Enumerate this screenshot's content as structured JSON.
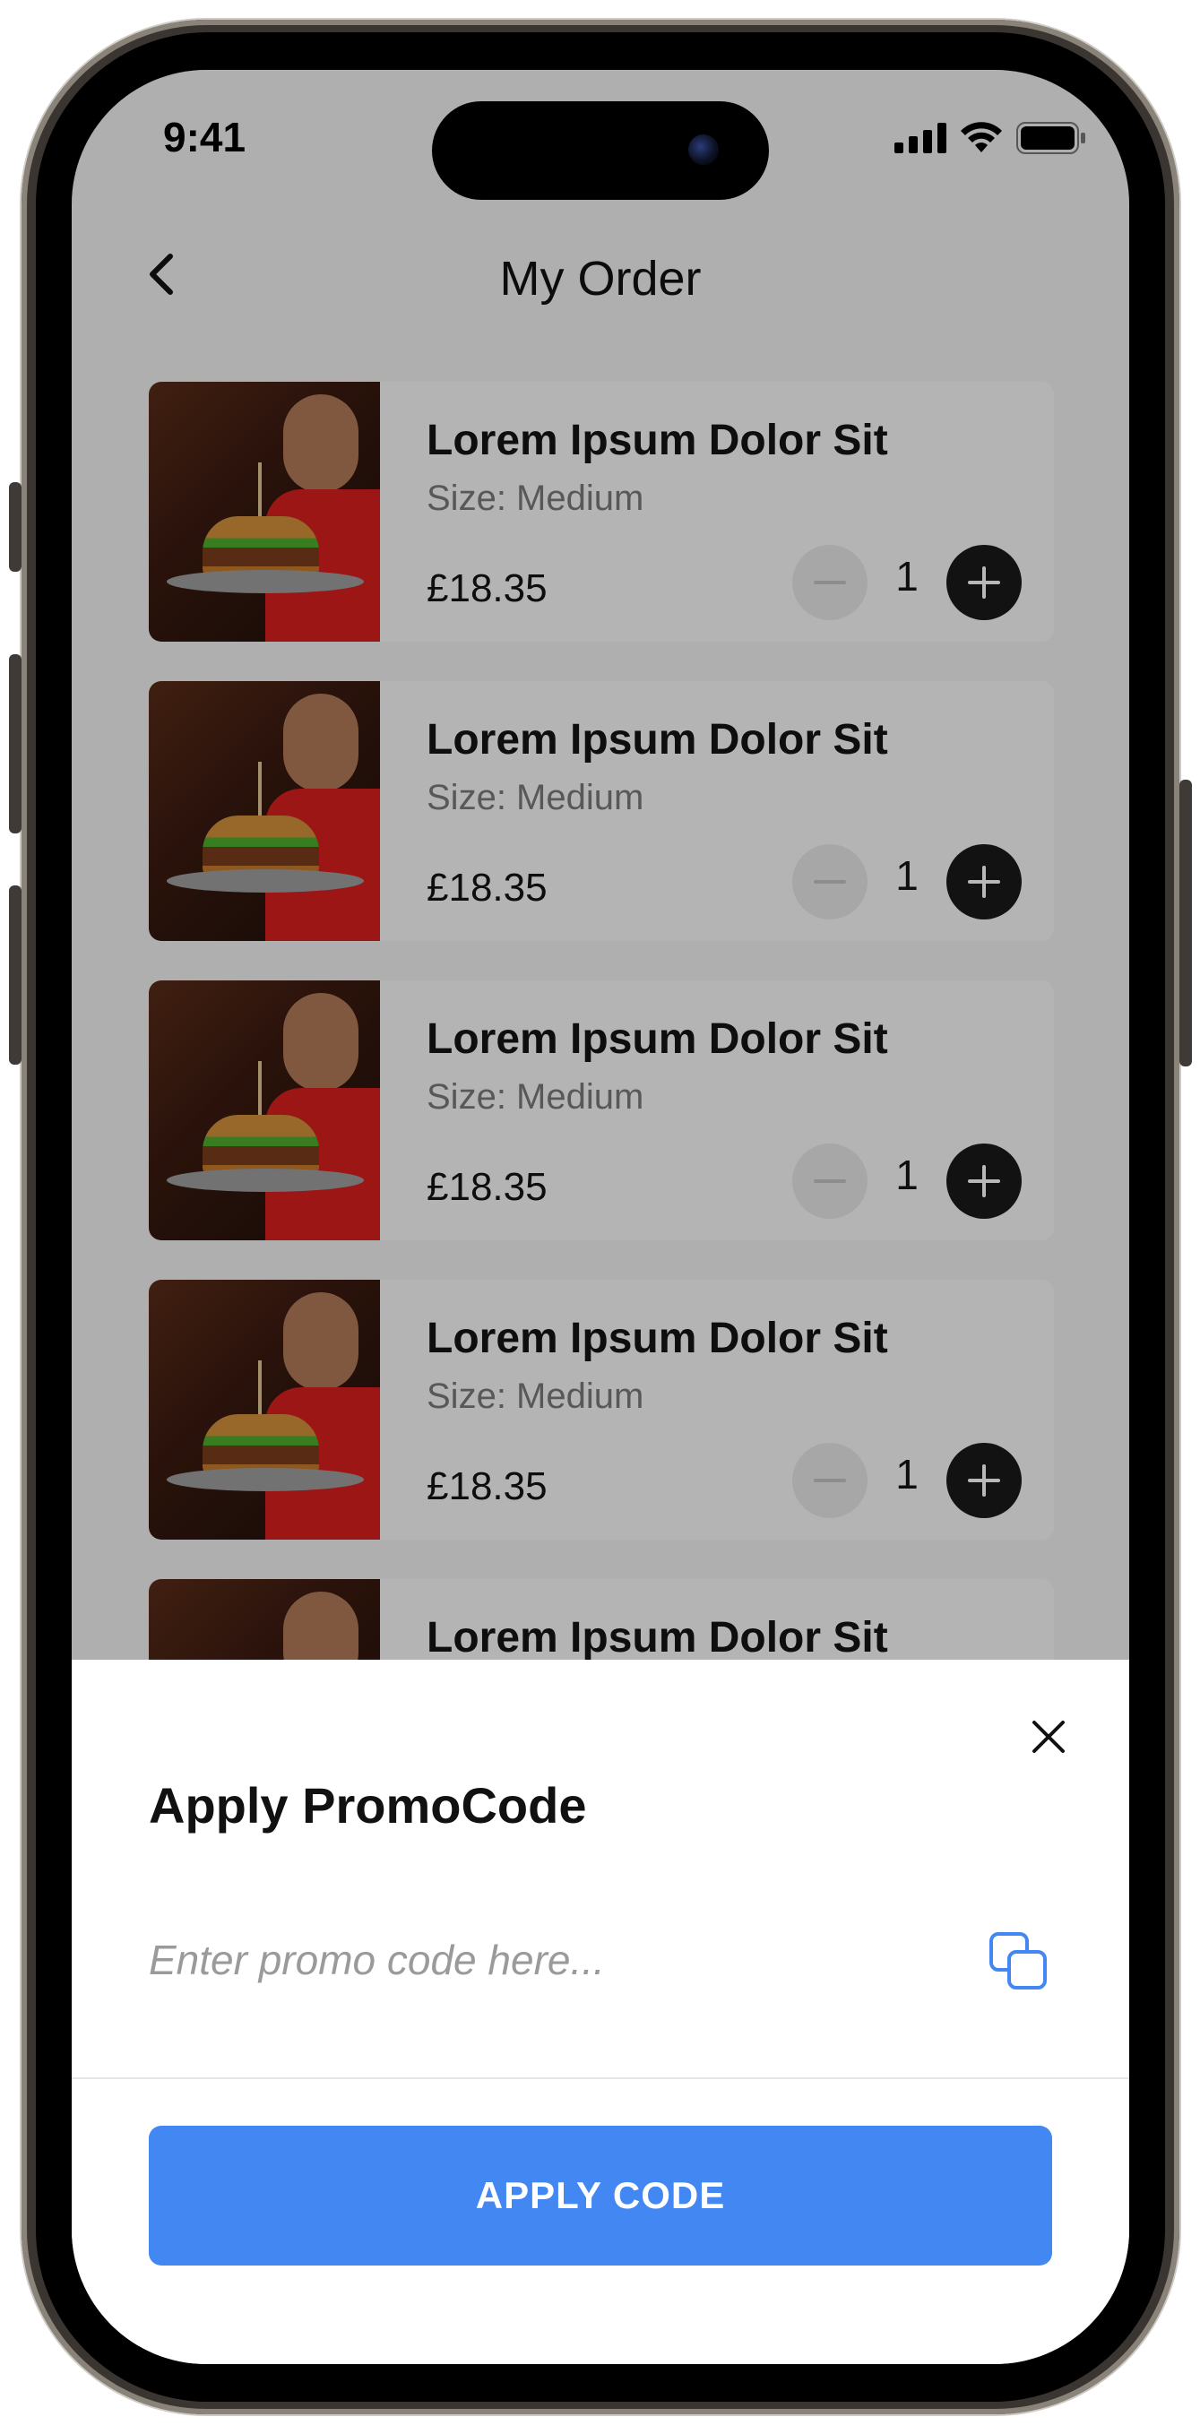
{
  "status_bar": {
    "time": "9:41"
  },
  "header": {
    "title": "My Order"
  },
  "items": [
    {
      "name": "Lorem Ipsum Dolor Sit",
      "size": "Size: Medium",
      "price": "£18.35",
      "qty": "1"
    },
    {
      "name": "Lorem Ipsum Dolor Sit",
      "size": "Size: Medium",
      "price": "£18.35",
      "qty": "1"
    },
    {
      "name": "Lorem Ipsum Dolor Sit",
      "size": "Size: Medium",
      "price": "£18.35",
      "qty": "1"
    },
    {
      "name": "Lorem Ipsum Dolor Sit",
      "size": "Size: Medium",
      "price": "£18.35",
      "qty": "1"
    },
    {
      "name": "Lorem Ipsum Dolor Sit"
    }
  ],
  "sheet": {
    "title": "Apply PromoCode",
    "input_placeholder": "Enter promo code here...",
    "button_label": "APPLY CODE"
  },
  "colors": {
    "accent": "#4387f2",
    "dark_button": "#1a1a1a"
  },
  "icons": [
    "back-chevron-icon",
    "minus-icon",
    "plus-icon",
    "close-icon",
    "copy-icon",
    "signal-icon",
    "wifi-icon",
    "battery-icon"
  ]
}
